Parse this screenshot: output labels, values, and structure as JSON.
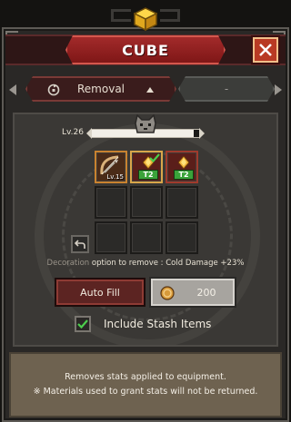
{
  "window": {
    "title": "CUBE"
  },
  "icons": {
    "emblem": "cube-icon",
    "close": "close-icon",
    "mode": "swap-icon",
    "caret": "caret-up-icon",
    "undo": "undo-icon",
    "coin": "coin-icon",
    "check": "checkmark-icon",
    "level_badge": "cat-icon"
  },
  "mode_selector": {
    "selected": "Removal",
    "secondary": "-"
  },
  "level": {
    "label": "Lv.26",
    "progress": 0.95
  },
  "slots": {
    "equipment": {
      "level_label": "Lv.15",
      "icon": "bow-icon"
    },
    "materials": [
      {
        "tier": "T2",
        "selected": true,
        "icon": "gem-icon"
      },
      {
        "tier": "T2",
        "selected": false,
        "icon": "gem-icon"
      }
    ],
    "empty_count": 6
  },
  "decoration": {
    "name": "Decoration",
    "text": "option to remove : Cold Damage +23%"
  },
  "buttons": {
    "auto_fill": "Auto Fill",
    "cost": "200"
  },
  "stash": {
    "label": "Include Stash Items",
    "checked": true
  },
  "info": {
    "line1": "Removes stats applied to equipment.",
    "line2": "※ Materials used to grant stats will not be returned."
  },
  "colors": {
    "title_red": "#a22a2a",
    "close_orange": "#b93a24",
    "tier_green": "#3aa33a",
    "check_green": "#4ccf4c",
    "panel_brown": "#6e6250"
  }
}
